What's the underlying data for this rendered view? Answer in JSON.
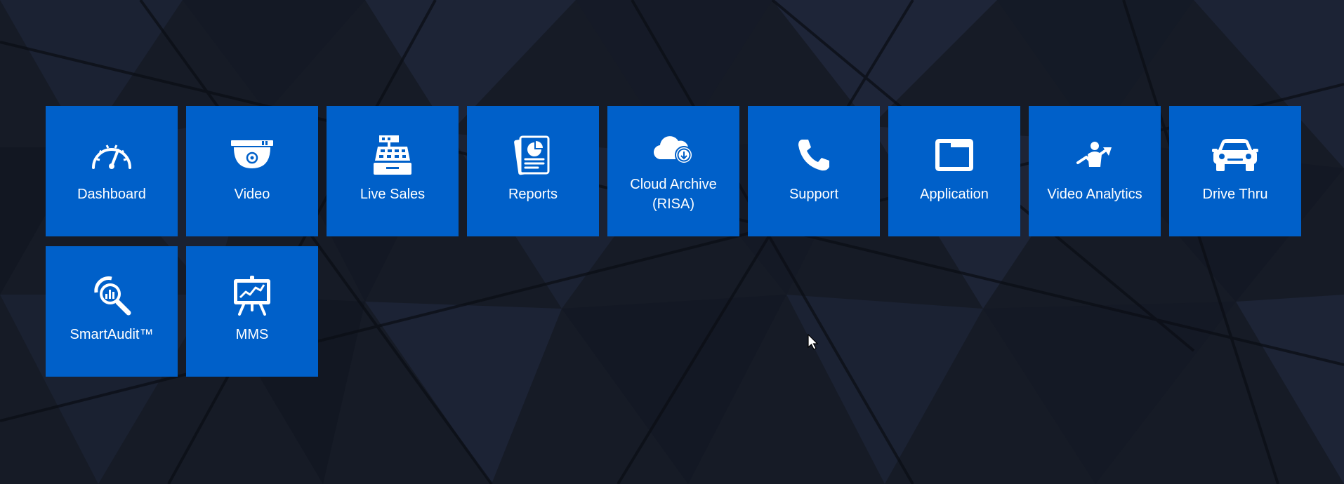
{
  "theme": {
    "tile_color": "#0060c9",
    "background_color": "#161b26",
    "label_color": "#ffffff"
  },
  "tiles": [
    {
      "label": "Dashboard",
      "icon": "speedometer-icon"
    },
    {
      "label": "Video",
      "icon": "dome-camera-icon"
    },
    {
      "label": "Live Sales",
      "icon": "cash-register-icon"
    },
    {
      "label": "Reports",
      "icon": "report-document-icon"
    },
    {
      "label_line1": "Cloud Archive",
      "label_line2": "(RISA)",
      "icon": "cloud-download-icon"
    },
    {
      "label": "Support",
      "icon": "phone-icon"
    },
    {
      "label": "Application",
      "icon": "window-icon"
    },
    {
      "label": "Video Analytics",
      "icon": "person-analytics-icon"
    },
    {
      "label": "Drive Thru",
      "icon": "car-icon"
    },
    {
      "label": "SmartAudit™",
      "icon": "magnifier-chart-icon"
    },
    {
      "label": "MMS",
      "icon": "presentation-board-icon"
    }
  ]
}
